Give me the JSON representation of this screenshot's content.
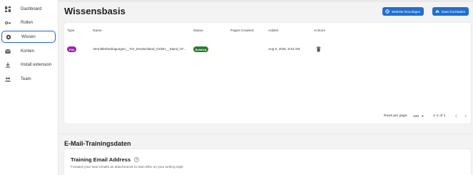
{
  "sidebar": {
    "items": [
      {
        "label": "Dashboard",
        "icon": "dashboard-icon"
      },
      {
        "label": "Rollen",
        "icon": "key-icon"
      },
      {
        "label": "Wissen",
        "icon": "brain-icon",
        "active": true
      },
      {
        "label": "Konten",
        "icon": "mail-icon"
      },
      {
        "label": "Install extension",
        "icon": "download-icon"
      },
      {
        "label": "Team",
        "icon": "people-icon"
      }
    ]
  },
  "header": {
    "title": "Wissensbasis",
    "add_website_label": "Website hinzufügen",
    "upload_file_label": "Datei hochladen"
  },
  "table": {
    "columns": [
      "Type",
      "Name",
      "Status",
      "Pages Crawled",
      "Added",
      "Actions"
    ],
    "rows": [
      {
        "type": "File",
        "name": "Vermittlerbedingungen__TUI_Deutschland_GmbH__Stand_07...",
        "status": "finished",
        "pages_crawled": "",
        "added": "Aug 6, 2025, 9:42 AM"
      }
    ]
  },
  "pagination": {
    "rows_per_page_label": "Rows per page:",
    "rows_per_page_value": "100",
    "range_label": "1–1 of 1"
  },
  "email_section": {
    "title": "E-Mail-Trainingsdaten",
    "card_title": "Training Email Address",
    "card_subtitle": "Forward your sent emails as attachments to train Ellie on your writing style"
  },
  "colors": {
    "accent": "#1f6fd1",
    "active_border": "#2d63c8",
    "file_chip": "#9c27b0",
    "status_finished": "#2e7d32"
  }
}
